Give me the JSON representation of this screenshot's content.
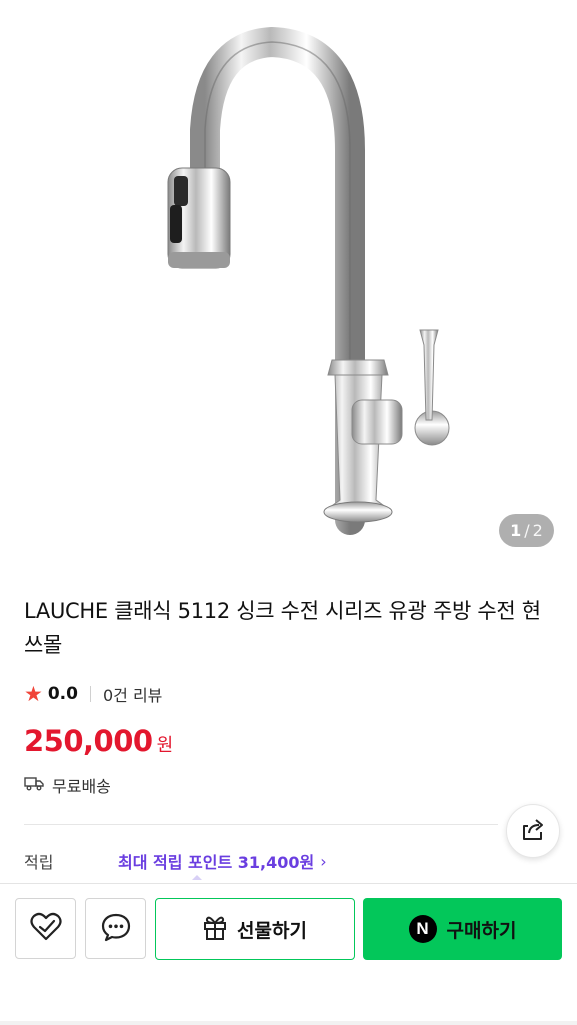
{
  "gallery": {
    "image_alt": "faucet",
    "current": "1",
    "separator": "/",
    "total": "2"
  },
  "product": {
    "title": "LAUCHE 클래식 5112 싱크 수전 시리즈 유광 주방 수전 현쓰몰",
    "rating": "0.0",
    "review_count": "0건 리뷰",
    "price": "250,000",
    "price_unit": "원",
    "shipping": "무료배송"
  },
  "points": {
    "label": "적립",
    "link_text": "최대 적립 포인트 31,400원",
    "chevron": "›"
  },
  "actions": {
    "gift_label": "선물하기",
    "buy_label": "구매하기",
    "buy_badge": "N"
  },
  "colors": {
    "price": "#e3172e",
    "accent_purple": "#6a3ee0",
    "naver_green": "#03c75a",
    "star": "#f04438"
  },
  "icons": {
    "share": "share-icon",
    "wishlist": "heart-check-icon",
    "talk": "chat-bubble-icon",
    "gift": "gift-icon",
    "shipping": "truck-icon",
    "star": "star-icon"
  }
}
